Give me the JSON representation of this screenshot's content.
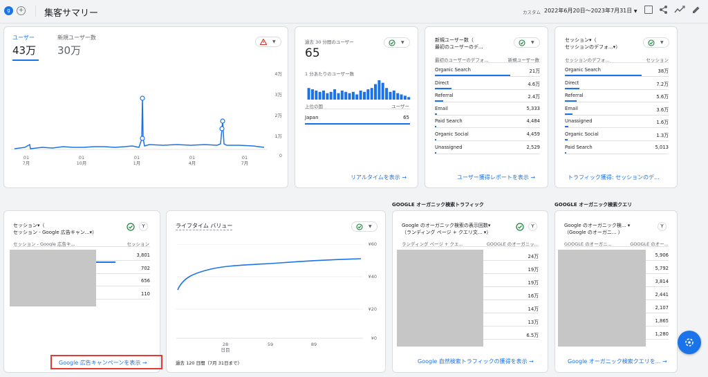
{
  "header": {
    "title": "集客サマリー",
    "date_label": "カスタム",
    "date_range": "2022年6月20日〜2023年7月31日",
    "avatar_letter": "g"
  },
  "card_users": {
    "tab1_label": "ユーザー",
    "tab1_value": "43万",
    "tab2_label": "新規ユーザー数",
    "tab2_value": "30万",
    "y_ticks": [
      "4万",
      "3万",
      "2万",
      "1万",
      "0"
    ],
    "x_ticks": [
      {
        "day": "01",
        "month": "7月"
      },
      {
        "day": "01",
        "month": "10月"
      },
      {
        "day": "01",
        "month": "1月"
      },
      {
        "day": "01",
        "month": "4月"
      },
      {
        "day": "01",
        "month": "7月"
      }
    ]
  },
  "card_realtime": {
    "title": "過去 30 分間のユーザー",
    "value": "65",
    "sub": "1 分あたりのユーザー数",
    "bars": [
      9,
      8,
      7,
      6,
      7,
      5,
      6,
      8,
      5,
      7,
      6,
      5,
      6,
      4,
      7,
      6,
      8,
      9,
      12,
      15,
      13,
      9,
      6,
      7,
      5,
      4,
      3,
      2
    ],
    "col1": "上位の国",
    "col2": "ユーザー",
    "rows": [
      {
        "name": "Japan",
        "value": "65"
      }
    ],
    "link": "リアルタイムを表示"
  },
  "card_new_users": {
    "title_line1": "新規ユーザー数（",
    "title_line2": "最初のユーザーのデ...",
    "col1": "最初のユーザーのデフォ...",
    "col2": "新規ユーザー数",
    "rows": [
      {
        "name": "Organic Search",
        "value": "21万",
        "share": 0.72
      },
      {
        "name": "Direct",
        "value": "4.6万",
        "share": 0.16
      },
      {
        "name": "Referral",
        "value": "2.4万",
        "share": 0.08
      },
      {
        "name": "Email",
        "value": "5,333",
        "share": 0.02
      },
      {
        "name": "Paid Search",
        "value": "4,484",
        "share": 0.015
      },
      {
        "name": "Organic Social",
        "value": "4,459",
        "share": 0.015
      },
      {
        "name": "Unassigned",
        "value": "2,529",
        "share": 0.01
      }
    ],
    "link": "ユーザー獲得レポートを表示"
  },
  "card_sessions": {
    "title_line1": "セッション▾（",
    "title_line2": "セッションのデフォ...▾）",
    "col1": "セッションのデフォ...",
    "col2": "セッション",
    "rows": [
      {
        "name": "Organic Search",
        "value": "38万",
        "share": 0.74
      },
      {
        "name": "Direct",
        "value": "7.2万",
        "share": 0.14
      },
      {
        "name": "Referral",
        "value": "5.6万",
        "share": 0.11
      },
      {
        "name": "Email",
        "value": "3.6万",
        "share": 0.07
      },
      {
        "name": "Unassigned",
        "value": "1.6万",
        "share": 0.03
      },
      {
        "name": "Organic Social",
        "value": "1.3万",
        "share": 0.025
      },
      {
        "name": "Paid Search",
        "value": "5,013",
        "share": 0.01
      }
    ],
    "link": "トラフィック獲得: セッションのデ..."
  },
  "card_ads": {
    "title_line1": "セッション▾（",
    "title_line2": "セッション - Google 広告キャン...▾）",
    "col1": "セッション - Google 広告キ...",
    "col2": "セッション",
    "values": [
      "3,801",
      "702",
      "656",
      "110"
    ],
    "link": "Google 広告キャンペーンを表示"
  },
  "card_ltv": {
    "title": "ライフタイム バリュー",
    "y_ticks": [
      "¥60",
      "¥40",
      "¥20",
      "¥0"
    ],
    "x_ticks": [
      "28\n日目",
      "59",
      "89"
    ],
    "footer": "過去 120 日間（7月 31日まで）"
  },
  "section_organic_traffic": "GOOGLE オーガニック検索トラフィック",
  "section_organic_queries": "GOOGLE オーガニック検索クエリ",
  "card_organic_traffic": {
    "title_line1": "Google のオーガニック検索の表示回数▾",
    "title_line2": "（ランディング ページ + クエリ文... ▾）",
    "col1": "ランディング ページ + クエ...",
    "col2": "GOOGLE のオーガニッ...",
    "values": [
      "24万",
      "19万",
      "19万",
      "16万",
      "14万",
      "13万",
      "6.5万"
    ],
    "link": "Google 自然検索トラフィックの獲得を表示"
  },
  "card_organic_queries": {
    "title_line1": "Google のオーガニック検... ▾",
    "title_line2": "（Google のオーガニ...  ）",
    "col1": "GOOGLE のオーガニ...",
    "col2": "GOOGLE のオー...",
    "values": [
      "5,906",
      "5,792",
      "3,814",
      "2,441",
      "2,107",
      "1,865",
      "1,280"
    ],
    "link": "Google オーガニック検索クエリを..."
  },
  "colors": {
    "accent": "#1a73e8",
    "ok": "#188038",
    "warn": "#d93025",
    "highlight": "#e53935"
  }
}
